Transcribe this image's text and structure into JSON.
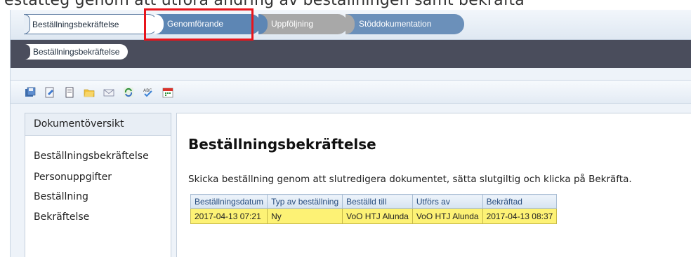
{
  "caption": "estatteg genom att utföra ändring av beställningen samt bekräfta",
  "workflow_tabs": [
    {
      "label": "Beställningsbekräftelse",
      "state": "active"
    },
    {
      "label": "Genomförande",
      "state": "blue"
    },
    {
      "label": "Uppföljning",
      "state": "gray"
    },
    {
      "label": "Stöddokumentation",
      "state": "blue"
    }
  ],
  "subnav": {
    "label": "Beställningsbekräftelse"
  },
  "toolbar": {
    "icons": [
      "save-icon",
      "edit-document-icon",
      "document-icon",
      "folder-icon",
      "mail-icon",
      "refresh-icon",
      "spellcheck-icon",
      "calendar-icon"
    ]
  },
  "sidebar": {
    "header": "Dokumentöversikt",
    "items": [
      {
        "label": "Beställningsbekräftelse"
      },
      {
        "label": "Personuppgifter"
      },
      {
        "label": "Beställning"
      },
      {
        "label": "Bekräftelse"
      }
    ]
  },
  "main": {
    "title": "Beställningsbekräftelse",
    "description": "Skicka beställning genom att slutredigera dokumentet, sätta slutgiltig och klicka på Bekräfta.",
    "table": {
      "headers": [
        "Beställningsdatum",
        "Typ av beställning",
        "Beställd till",
        "Utförs av",
        "Bekräftad"
      ],
      "rows": [
        [
          "2017-04-13 07:21",
          "Ny",
          "VoO HTJ Alunda",
          "VoO HTJ Alunda",
          "2017-04-13 08:37"
        ]
      ]
    }
  },
  "colors": {
    "accent_blue": "#5d86b4",
    "tab_gray": "#a8a8a8",
    "subbar_dark": "#4a4d5c",
    "row_highlight": "#fdf275",
    "annotation_red": "#e8141b"
  }
}
